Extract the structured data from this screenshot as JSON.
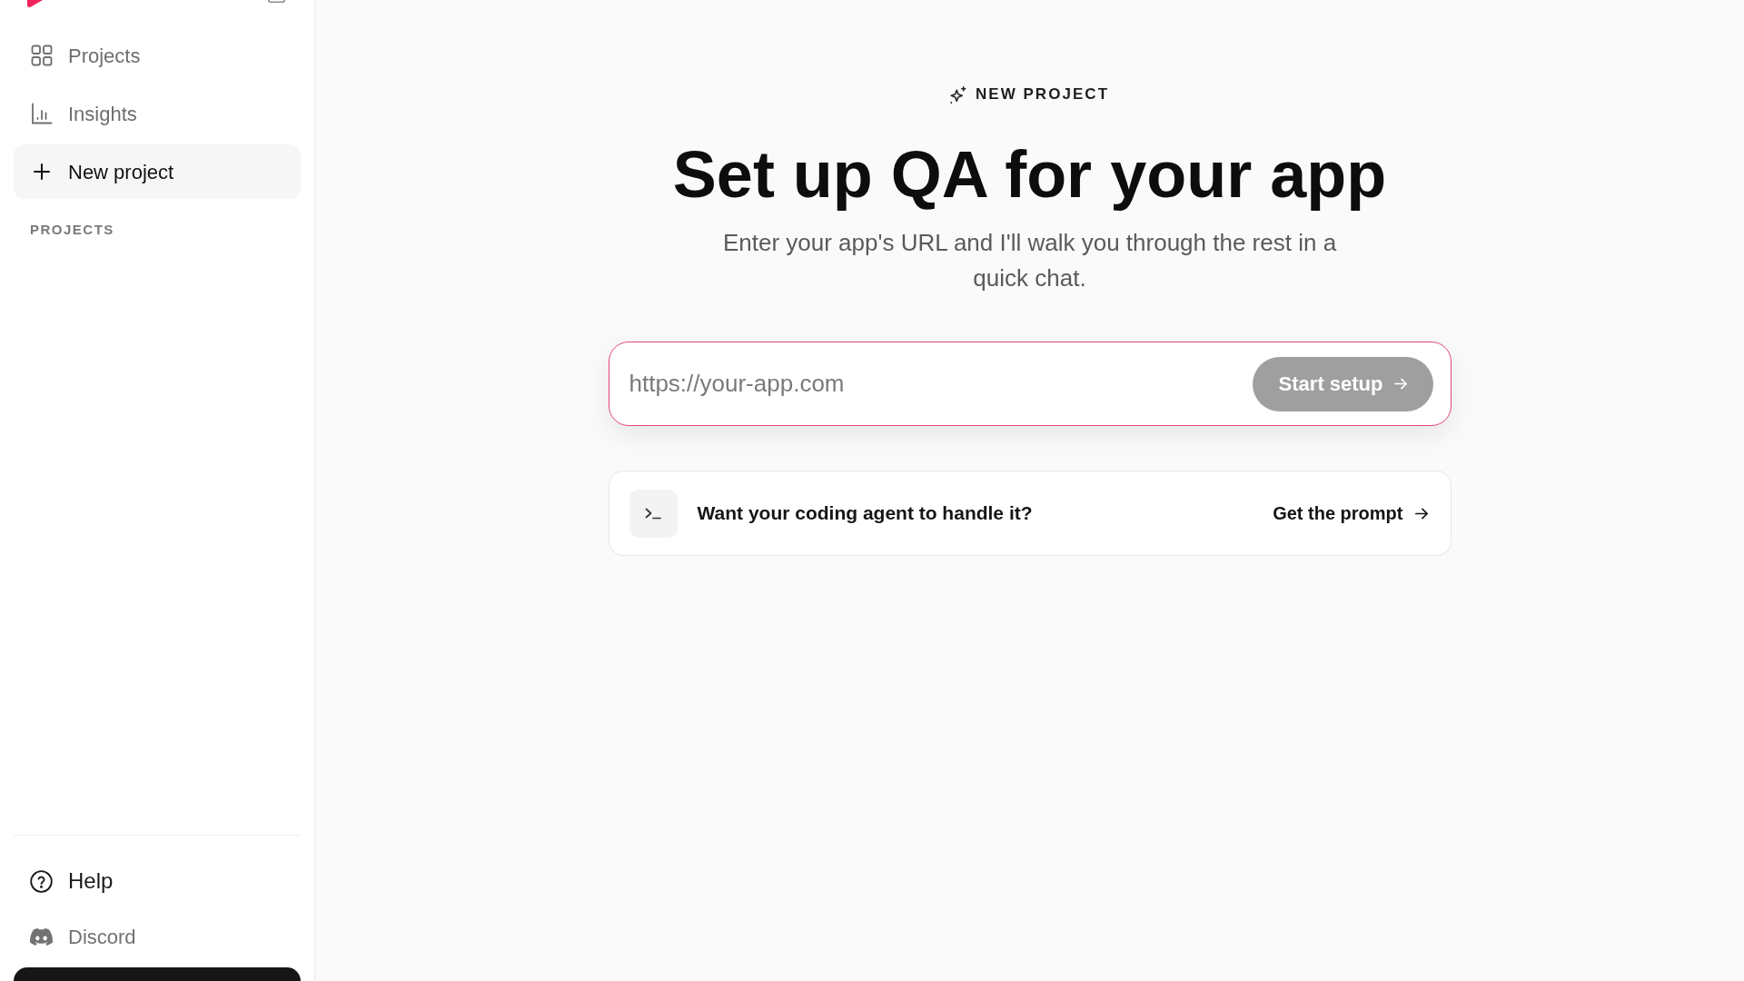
{
  "sidebar": {
    "nav": [
      {
        "label": "Projects",
        "selected": false
      },
      {
        "label": "Insights",
        "selected": false
      },
      {
        "label": "New project",
        "selected": true
      }
    ],
    "section_title": "PROJECTS",
    "footer": [
      {
        "label": "Help",
        "kind": "button"
      },
      {
        "label": "Discord",
        "kind": "link"
      }
    ]
  },
  "main": {
    "eyebrow": "NEW PROJECT",
    "title": "Set up QA for your app",
    "subtitle": "Enter your app's URL and I'll walk you through the rest in a quick chat.",
    "url_field": {
      "placeholder": "https://your-app.com",
      "focused": true
    },
    "start_button": {
      "label": "Start setup",
      "disabled": true
    },
    "agent_card": {
      "text": "Want your coding agent to handle it?",
      "link": "Get the prompt"
    }
  }
}
